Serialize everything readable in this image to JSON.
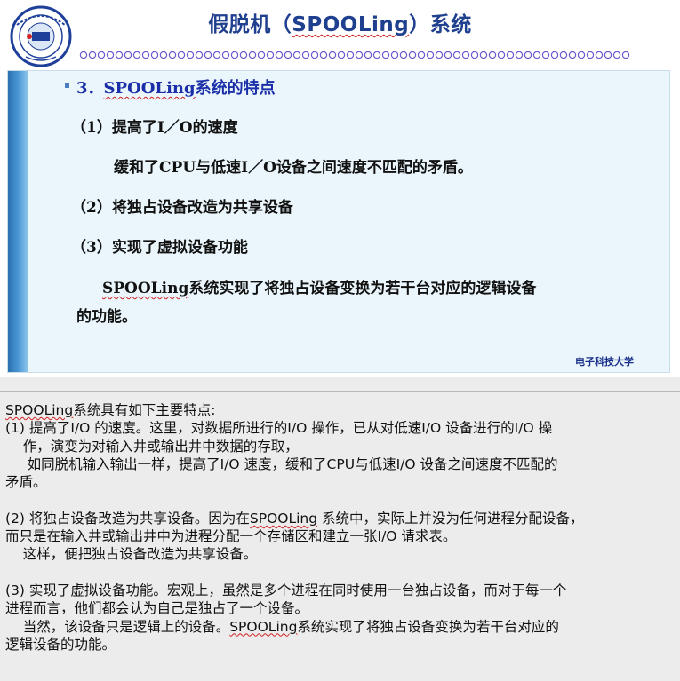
{
  "slide": {
    "title_pre": "假脱机（",
    "title_mid": "SPOOLing",
    "title_post": "）系统",
    "heading_num": "3．",
    "heading_word": "SPOOLing",
    "heading_rest": "系统的特点",
    "item1": "（1）提高了I／O的速度",
    "item1_detail": "缓和了CPU与低速I／O设备之间速度不匹配的矛盾。",
    "item2": "（2）将独占设备改造为共享设备",
    "item3": "（3）实现了虚拟设备功能",
    "para_word": "SPOOLing",
    "para_line1_rest": "系统实现了将独占设备变换为若干台对应的逻辑设备",
    "para_line2": "的功能。",
    "footer": "电子科技大学",
    "accent_color": "#1f3f8f",
    "logo_icon": "uestc-seal-icon"
  },
  "notes": {
    "l1_word": "SPOOLing",
    "l1_rest": "系统具有如下主要特点:",
    "l2": "(1) 提高了I/O 的速度。这里，对数据所进行的I/O 操作，已从对低速I/O 设备进行的I/O 操",
    "l3": "    作，演变为对输入井或输出井中数据的存取，",
    "l4": "     如同脱机输入输出一样，提高了I/O 速度，缓和了CPU与低速I/O 设备之间速度不匹配的",
    "l5": "矛盾。",
    "l6_pre": "(2) 将独占设备改造为共享设备。因为在",
    "l6_word": "SPOOLing",
    "l6_post": " 系统中，实际上并没为任何进程分配设备，",
    "l7": "而只是在输入井或输出井中为进程分配一个存储区和建立一张I/O 请求表。",
    "l8": "    这样，便把独占设备改造为共享设备。",
    "l9": "(3) 实现了虚拟设备功能。宏观上，虽然是多个进程在同时使用一台独占设备，而对于每一个",
    "l10": "进程而言，他们都会认为自己是独占了一个设备。",
    "l11_pre": "    当然，该设备只是逻辑上的设备。",
    "l11_word": "SPOOLing",
    "l11_post": "系统实现了将独占设备变换为若干台对应的",
    "l12": "逻辑设备的功能。"
  }
}
